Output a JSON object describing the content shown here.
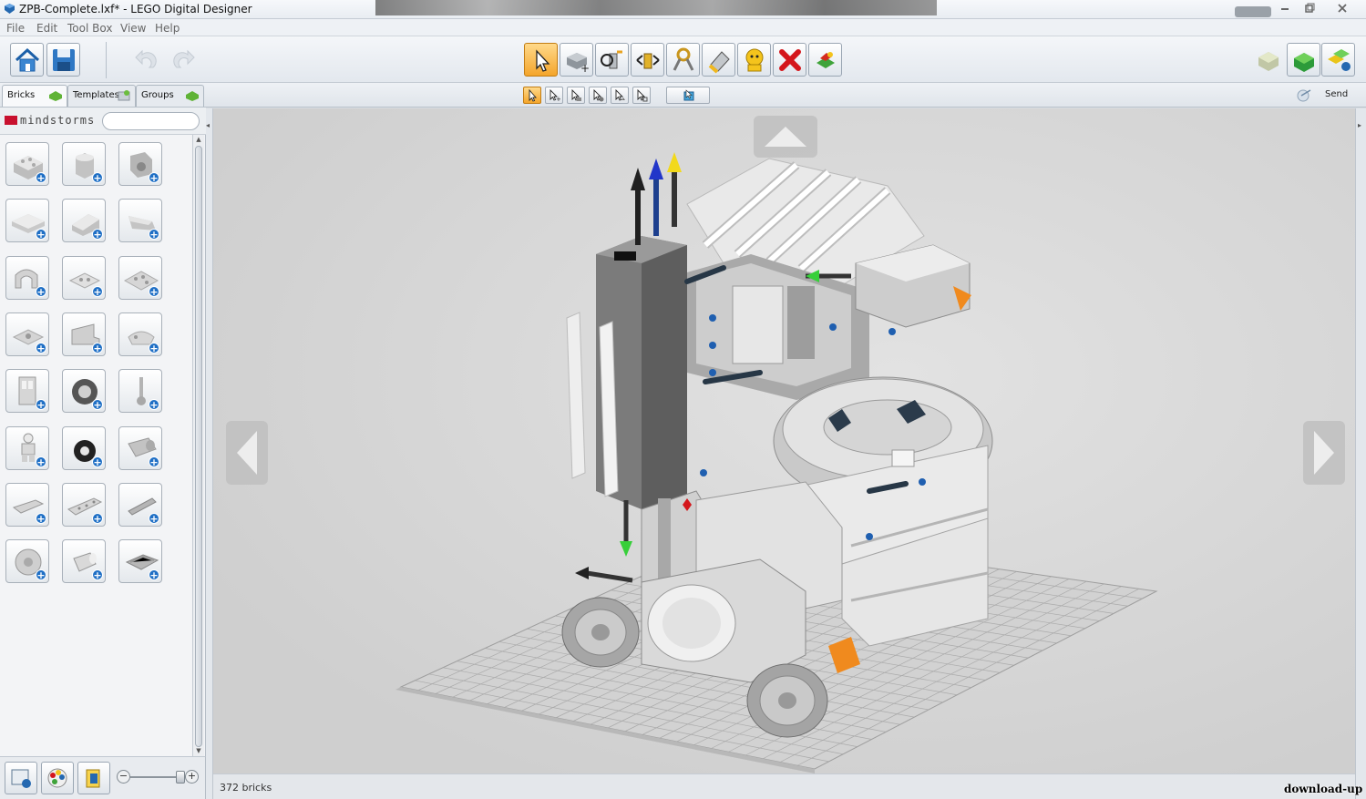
{
  "window": {
    "title": "ZPB-Complete.lxf* - LEGO Digital Designer"
  },
  "menu": {
    "items": [
      "File",
      "Edit",
      "Tool Box",
      "View",
      "Help"
    ]
  },
  "toolbar": {
    "left_icons": [
      "home-icon",
      "save-icon",
      "undo-icon",
      "redo-icon"
    ],
    "tools": [
      "select-tool-icon",
      "clone-tool-icon",
      "hinge-tool-icon",
      "hinge-align-tool-icon",
      "flex-tool-icon",
      "paint-tool-icon",
      "hide-tool-icon",
      "delete-tool-icon",
      "decorate-tool-icon"
    ],
    "mode_icons": [
      "build-mode-icon",
      "view-mode-icon",
      "instructions-mode-icon"
    ]
  },
  "tabs": {
    "bricks": "Bricks",
    "templates": "Templates",
    "groups": "Groups"
  },
  "subtools": [
    "single-select-icon",
    "multi-select-icon",
    "select-connected-icon",
    "select-same-color-icon",
    "select-same-shape-icon",
    "invert-select-icon"
  ],
  "send": {
    "label": "Send"
  },
  "palette": {
    "brand": "mindstorms",
    "search_placeholder": "",
    "bricks": [
      "brick-2x4",
      "brick-round",
      "brick-technic-corner",
      "plate-1x6",
      "slope-brick",
      "wedge-brick",
      "arch-brick",
      "plate-2x2",
      "plate-2x3",
      "jumper-plate",
      "panel-brick",
      "minifig-accessory",
      "door-brick",
      "gear-wheel",
      "wrench-tool",
      "minifigure",
      "tire-wheel",
      "engine-part",
      "technic-beam-short",
      "technic-beam-long",
      "technic-axle",
      "gear-disc",
      "cylinder-brick",
      "grille-plate"
    ]
  },
  "status": {
    "brick_count": "372 bricks"
  },
  "watermark": "download-up"
}
